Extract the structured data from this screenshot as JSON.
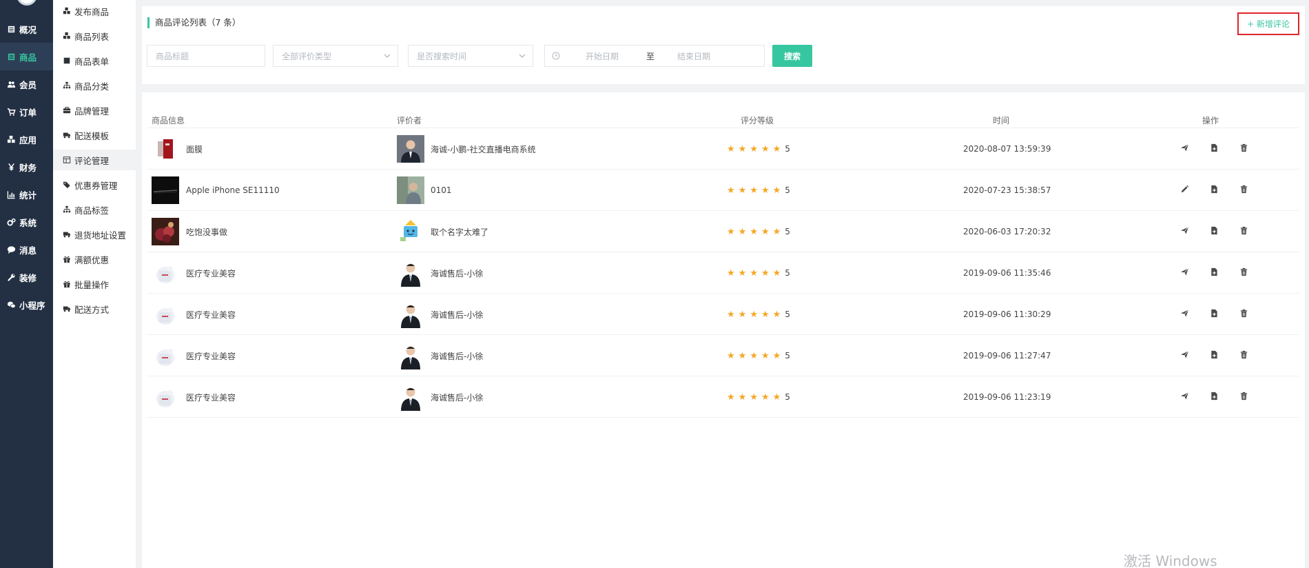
{
  "nav_primary": {
    "items": [
      {
        "label": "概况",
        "icon": "list-icon"
      },
      {
        "label": "商品",
        "icon": "list-icon"
      },
      {
        "label": "会员",
        "icon": "users-icon"
      },
      {
        "label": "订单",
        "icon": "cart-icon"
      },
      {
        "label": "应用",
        "icon": "cubes-icon"
      },
      {
        "label": "财务",
        "icon": "yen-icon"
      },
      {
        "label": "统计",
        "icon": "chart-icon"
      },
      {
        "label": "系统",
        "icon": "gears-icon"
      },
      {
        "label": "消息",
        "icon": "chat-icon"
      },
      {
        "label": "装修",
        "icon": "wrench-icon"
      },
      {
        "label": "小程序",
        "icon": "wechat-icon"
      }
    ],
    "active_index": 1
  },
  "nav_secondary": {
    "items": [
      {
        "label": "发布商品",
        "icon": "cubes-icon"
      },
      {
        "label": "商品列表",
        "icon": "cubes-icon"
      },
      {
        "label": "商品表单",
        "icon": "list-icon"
      },
      {
        "label": "商品分类",
        "icon": "sitemap-icon"
      },
      {
        "label": "品牌管理",
        "icon": "briefcase-icon"
      },
      {
        "label": "配送模板",
        "icon": "truck-icon"
      },
      {
        "label": "评论管理",
        "icon": "table-icon"
      },
      {
        "label": "优惠券管理",
        "icon": "tag-icon"
      },
      {
        "label": "商品标签",
        "icon": "sitemap-icon"
      },
      {
        "label": "退货地址设置",
        "icon": "truck-icon"
      },
      {
        "label": "满额优惠",
        "icon": "gift-icon"
      },
      {
        "label": "批量操作",
        "icon": "gift-icon"
      },
      {
        "label": "配送方式",
        "icon": "truck-icon"
      }
    ],
    "active_index": 6
  },
  "header": {
    "title": "商品评论列表（7 条）",
    "add_button": "+ 新增评论"
  },
  "filters": {
    "title_placeholder": "商品标题",
    "rating_type": "全部评价类型",
    "search_time": "是否搜索时间",
    "start_date_placeholder": "开始日期",
    "separator": "至",
    "end_date_placeholder": "结束日期",
    "search_button": "搜索"
  },
  "table": {
    "columns": [
      "商品信息",
      "评价者",
      "评分等级",
      "时间",
      "操作"
    ],
    "rows": [
      {
        "product": "面膜",
        "reviewer": "海诚-小鹏-社交直播电商系统",
        "score": "5",
        "time": "2020-08-07 13:59:39",
        "first_action": "send-icon"
      },
      {
        "product": "Apple iPhone SE11110",
        "reviewer": "0101",
        "score": "5",
        "time": "2020-07-23 15:38:57",
        "first_action": "edit-icon"
      },
      {
        "product": "吃饱没事做",
        "reviewer": "取个名字太难了",
        "score": "5",
        "time": "2020-06-03 17:20:32",
        "first_action": "send-icon"
      },
      {
        "product": "医疗专业美容",
        "reviewer": "海诚售后-小徐",
        "score": "5",
        "time": "2019-09-06 11:35:46",
        "first_action": "send-icon"
      },
      {
        "product": "医疗专业美容",
        "reviewer": "海诚售后-小徐",
        "score": "5",
        "time": "2019-09-06 11:30:29",
        "first_action": "send-icon"
      },
      {
        "product": "医疗专业美容",
        "reviewer": "海诚售后-小徐",
        "score": "5",
        "time": "2019-09-06 11:27:47",
        "first_action": "send-icon"
      },
      {
        "product": "医疗专业美容",
        "reviewer": "海诚售后-小徐",
        "score": "5",
        "time": "2019-09-06 11:23:19",
        "first_action": "send-icon"
      }
    ]
  },
  "colors": {
    "accent": "#36c6a0",
    "sidebar": "#233044",
    "star": "#f5a623",
    "highlight": "#e0242a"
  },
  "watermark": "激活 Windows"
}
